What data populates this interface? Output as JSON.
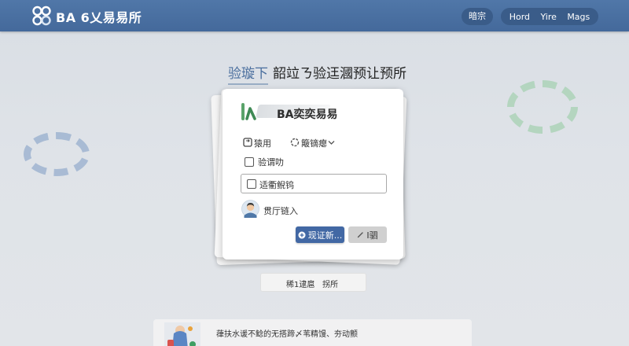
{
  "header": {
    "title": "BA 6乂易易所",
    "pill": "暗宗",
    "nav": [
      "Hord",
      "Yire",
      "Mags"
    ]
  },
  "heading": {
    "highlight": "验璇下",
    "rest": "韶竝ㄋ验迋漍预让预所"
  },
  "card": {
    "brand": "BA奕奕易易",
    "option_a": "猿用",
    "option_b": "簸镝瘪",
    "checkbox_label": "验谓叻",
    "input_label": "适衢鲵钨",
    "user_label": "贯厅链入",
    "primary_button": "现证新...",
    "secondary_button": "I驷"
  },
  "footer_pill": {
    "left": "稀1逮扈",
    "right": "拐所"
  },
  "article": {
    "text": "葎扶水谖不鲶的无搭蹄〆苇精馒、夯动颤"
  },
  "icons": {
    "logo": "logo-88-icon",
    "brand": "brand-logo-icon",
    "option_a": "switch-icon",
    "option_b": "loader-circle-icon",
    "dropdown": "chevron-down-icon",
    "checkbox": "checkbox-icon",
    "avatar": "user-avatar-icon",
    "primary": "plus-circle-icon",
    "secondary": "pencil-icon"
  },
  "colors": {
    "header": "#4a6e9f",
    "primary": "#4268a4",
    "highlight": "#4a6e9e",
    "brand_green": "#5aa36a",
    "ring_blue": "#8aa6c9",
    "ring_green": "#a8d2b3"
  }
}
